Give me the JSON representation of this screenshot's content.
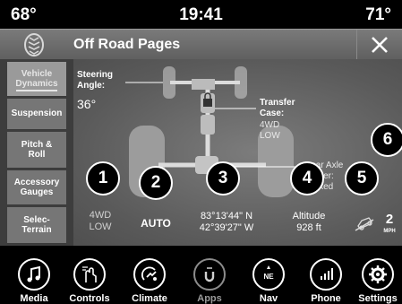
{
  "status_bar": {
    "temp_left": "68°",
    "time": "19:41",
    "temp_right": "71°"
  },
  "header": {
    "title": "Off Road Pages",
    "close_label": "×"
  },
  "sidebar": {
    "items": [
      {
        "label": "Vehicle Dynamics",
        "active": true
      },
      {
        "label": "Suspension",
        "active": false
      },
      {
        "label": "Pitch & Roll",
        "active": false
      },
      {
        "label": "Accessory Gauges",
        "active": false
      },
      {
        "label": "Selec-Terrain",
        "active": false
      }
    ]
  },
  "main": {
    "steering_label": "Steering Angle:",
    "steering_value": "36°",
    "transfer_case_label": "Transfer Case:",
    "transfer_case_value": "4WD LOW",
    "rear_locker_label": "Rear Axle Locker: Locked",
    "drive_mode": "4WD LOW",
    "mode": "AUTO",
    "coord_n": "83°13'44\" N",
    "coord_w": "42°39'27\" W",
    "altitude_label": "Altitude",
    "altitude_value": "928 ft",
    "speed_value": "2",
    "speed_unit": "MPH"
  },
  "callouts": [
    "1",
    "2",
    "3",
    "4",
    "5",
    "6"
  ],
  "dock": {
    "items": [
      {
        "label": "Media",
        "icon": "music-note-icon",
        "enabled": true
      },
      {
        "label": "Controls",
        "icon": "hand-controls-icon",
        "enabled": true
      },
      {
        "label": "Climate",
        "icon": "climate-icon",
        "enabled": true
      },
      {
        "label": "Apps",
        "icon": "apps-icon",
        "enabled": false
      },
      {
        "label": "Nav",
        "icon": "compass-ne-icon",
        "enabled": true
      },
      {
        "label": "Phone",
        "icon": "phone-icon",
        "enabled": true
      },
      {
        "label": "Settings",
        "icon": "gear-icon",
        "enabled": true
      }
    ]
  },
  "colors": {
    "background": "#000000",
    "header": "#6b6b6b",
    "sidebar_tab": "#767676",
    "panel": "#6a6a6a",
    "text": "#ffffff"
  }
}
